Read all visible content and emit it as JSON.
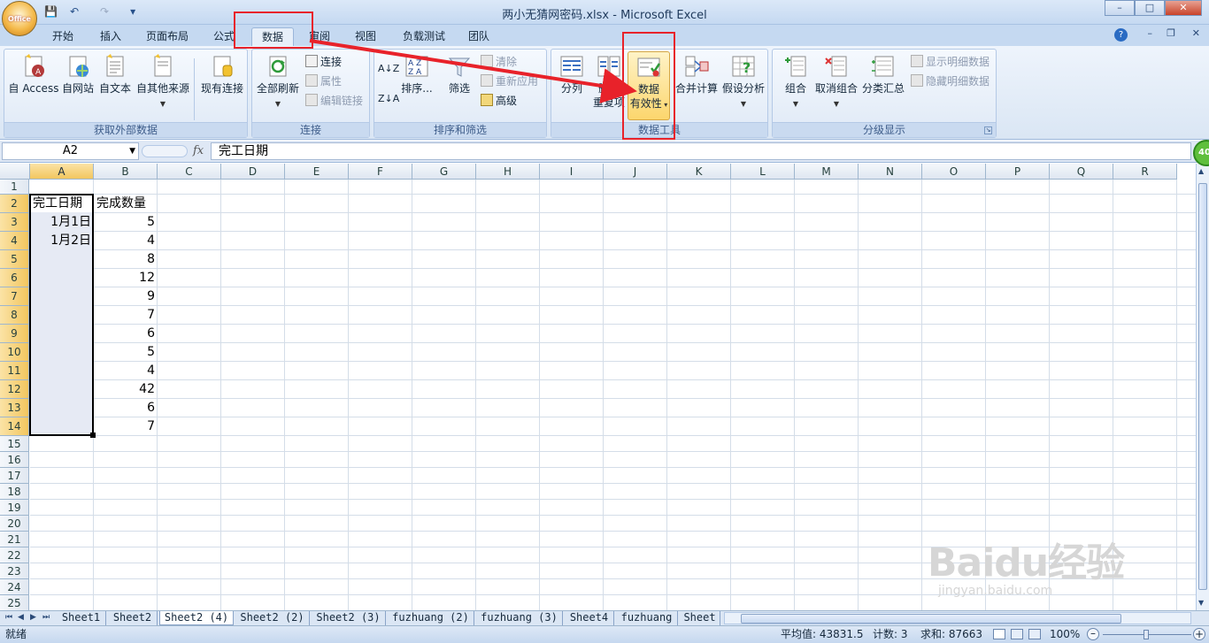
{
  "window": {
    "title": "两小无猜网密码.xlsx - Microsoft Excel",
    "minimize": "–",
    "maximize": "□",
    "close": "✕",
    "office_button_label": "Office"
  },
  "quick_access": {
    "save": "💾",
    "undo": "↶",
    "redo": "↷",
    "customize": "▾"
  },
  "tabs": [
    "开始",
    "插入",
    "页面布局",
    "公式",
    "数据",
    "审阅",
    "视图",
    "负载测试",
    "团队"
  ],
  "active_tab": "数据",
  "tabbar_right": {
    "help": "?",
    "min": "–",
    "restore": "❐",
    "close": "✕"
  },
  "ribbon": {
    "get_external": {
      "label": "获取外部数据",
      "buttons": [
        "自 Access",
        "自网站",
        "自文本",
        "自其他来源",
        "现有连接"
      ]
    },
    "connections": {
      "label": "连接",
      "refresh_all": "全部刷新",
      "connection": "连接",
      "properties": "属性",
      "edit_links": "编辑链接"
    },
    "sort_filter": {
      "label": "排序和筛选",
      "sort_az": "A↓Z",
      "sort_za": "Z↓A",
      "sort": "排序...",
      "filter": "筛选",
      "clear": "清除",
      "reapply": "重新应用",
      "advanced": "高级"
    },
    "data_tools": {
      "label": "数据工具",
      "text_to_columns": "分列",
      "remove_dup_1": "删除",
      "remove_dup_2": "重复项",
      "validation_1": "数据",
      "validation_2": "有效性",
      "consolidate": "合并计算",
      "what_if": "假设分析"
    },
    "outline": {
      "label": "分级显示",
      "group": "组合",
      "ungroup": "取消组合",
      "subtotal": "分类汇总",
      "show_detail": "显示明细数据",
      "hide_detail": "隐藏明细数据"
    }
  },
  "formula_bar": {
    "name_box": "A2",
    "fx": "fx",
    "content": "完工日期"
  },
  "columns": [
    "A",
    "B",
    "C",
    "D",
    "E",
    "F",
    "G",
    "H",
    "I",
    "J",
    "K",
    "L",
    "M",
    "N",
    "O",
    "P",
    "Q",
    "R"
  ],
  "rows": [
    "1",
    "2",
    "3",
    "4",
    "5",
    "6",
    "7",
    "8",
    "9",
    "10",
    "11",
    "12",
    "13",
    "14",
    "15",
    "16",
    "17",
    "18",
    "19",
    "20",
    "21",
    "22",
    "23",
    "24",
    "25"
  ],
  "cells": {
    "A2": "完工日期",
    "B2": "完成数量",
    "A3": "1月1日",
    "A4": "1月2日",
    "B3": "5",
    "B4": "4",
    "B5": "8",
    "B6": "12",
    "B7": "9",
    "B8": "7",
    "B9": "6",
    "B10": "5",
    "B11": "4",
    "B12": "42",
    "B13": "6",
    "B14": "7"
  },
  "sheets": [
    "Sheet1",
    "Sheet2",
    "Sheet2 (4)",
    "Sheet2 (2)",
    "Sheet2 (3)",
    "fuzhuang (2)",
    "fuzhuang (3)",
    "Sheet4",
    "fuzhuang",
    "Sheet"
  ],
  "active_sheet": "Sheet2 (4)",
  "sheet_nav": [
    "⏮",
    "◀",
    "▶",
    "⏭"
  ],
  "status": {
    "ready": "就绪",
    "average": "平均值: 43831.5",
    "count": "计数: 3",
    "sum": "求和: 87663",
    "zoom": "100%"
  },
  "badge": "40",
  "watermark": {
    "brand": "Baidu经验",
    "url": "jingyan.baidu.com"
  },
  "colors": {
    "accent": "#e8222a",
    "ribbon": "#dae6f4",
    "selection": "#f2c65f"
  }
}
